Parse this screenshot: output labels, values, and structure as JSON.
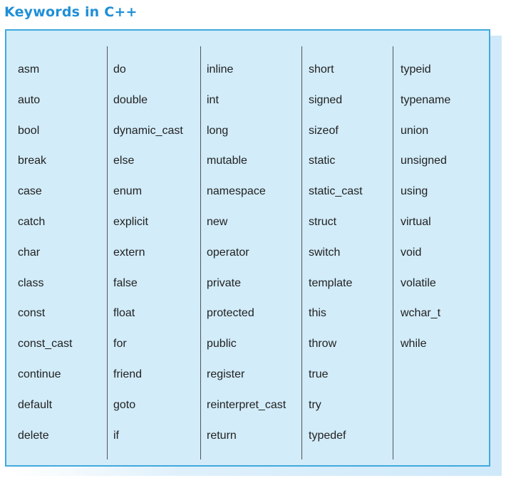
{
  "title": "Keywords in C++",
  "columns": [
    [
      "asm",
      "auto",
      "bool",
      "break",
      "case",
      "catch",
      "char",
      "class",
      "const",
      "const_cast",
      "continue",
      "default",
      "delete"
    ],
    [
      "do",
      "double",
      "dynamic_cast",
      "else",
      "enum",
      "explicit",
      "extern",
      "false",
      "float",
      "for",
      "friend",
      "goto",
      "if"
    ],
    [
      "inline",
      "int",
      "long",
      "mutable",
      "namespace",
      "new",
      "operator",
      "private",
      "protected",
      "public",
      "register",
      "reinterpret_cast",
      "return"
    ],
    [
      "short",
      "signed",
      "sizeof",
      "static",
      "static_cast",
      "struct",
      "switch",
      "template",
      "this",
      "throw",
      "true",
      "try",
      "typedef"
    ],
    [
      "typeid",
      "typename",
      "union",
      "unsigned",
      "using",
      "virtual",
      "void",
      "volatile",
      "wchar_t",
      "while"
    ]
  ]
}
